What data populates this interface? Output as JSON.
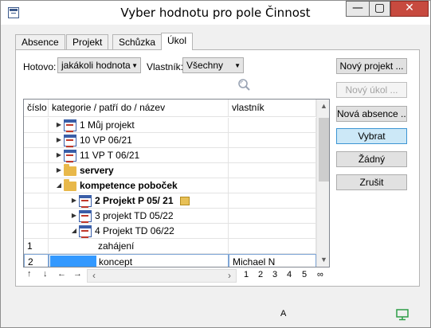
{
  "window": {
    "title": "Vyber hodnotu pro pole Činnost",
    "min_glyph": "—",
    "max_glyph": "▢",
    "close_glyph": "✕"
  },
  "tabs": [
    "Absence",
    "Projekt",
    "Schůzka",
    "Úkol"
  ],
  "active_tab": "Úkol",
  "filters": {
    "hotovo_label": "Hotovo:",
    "hotovo_value": "jakákoli hodnota",
    "vlastnik_label": "Vlastník:",
    "vlastnik_value": "Všechny"
  },
  "buttons": {
    "new_project": "Nový projekt ...",
    "new_task": "Nový úkol ...",
    "new_absence": "Nová absence ...",
    "select": "Vybrat",
    "none": "Žádný",
    "cancel": "Zrušit"
  },
  "grid": {
    "columns": [
      "číslo",
      "kategorie / patří do / název",
      "vlastník"
    ],
    "rows": [
      {
        "cislo": "",
        "nazev": "1 Můj projekt",
        "vlastnik": ""
      },
      {
        "cislo": "",
        "nazev": "10 VP 06/21",
        "vlastnik": ""
      },
      {
        "cislo": "",
        "nazev": "11 VP T  06/21",
        "vlastnik": ""
      },
      {
        "cislo": "",
        "nazev": "servery",
        "vlastnik": ""
      },
      {
        "cislo": "",
        "nazev": "kompetence poboček",
        "vlastnik": ""
      },
      {
        "cislo": "",
        "nazev": "2 Projekt P 05/ 21",
        "vlastnik": ""
      },
      {
        "cislo": "",
        "nazev": "3 projekt TD 05/22",
        "vlastnik": ""
      },
      {
        "cislo": "",
        "nazev": "4 Projekt TD 06/22",
        "vlastnik": ""
      },
      {
        "cislo": "1",
        "nazev": "zahájení",
        "vlastnik": ""
      },
      {
        "cislo": "2",
        "nazev": "koncept",
        "vlastnik": "Michael N"
      }
    ]
  },
  "navigation": {
    "arrows": [
      "↑",
      "↓",
      "←",
      "→"
    ],
    "pages": [
      "1",
      "2",
      "3",
      "4",
      "5",
      "∞"
    ]
  },
  "status": {
    "indicator": "A"
  },
  "colors": {
    "selected_cell": "#3399ff",
    "primary_button": "#cce8f7",
    "close_button": "#c74a3f"
  }
}
